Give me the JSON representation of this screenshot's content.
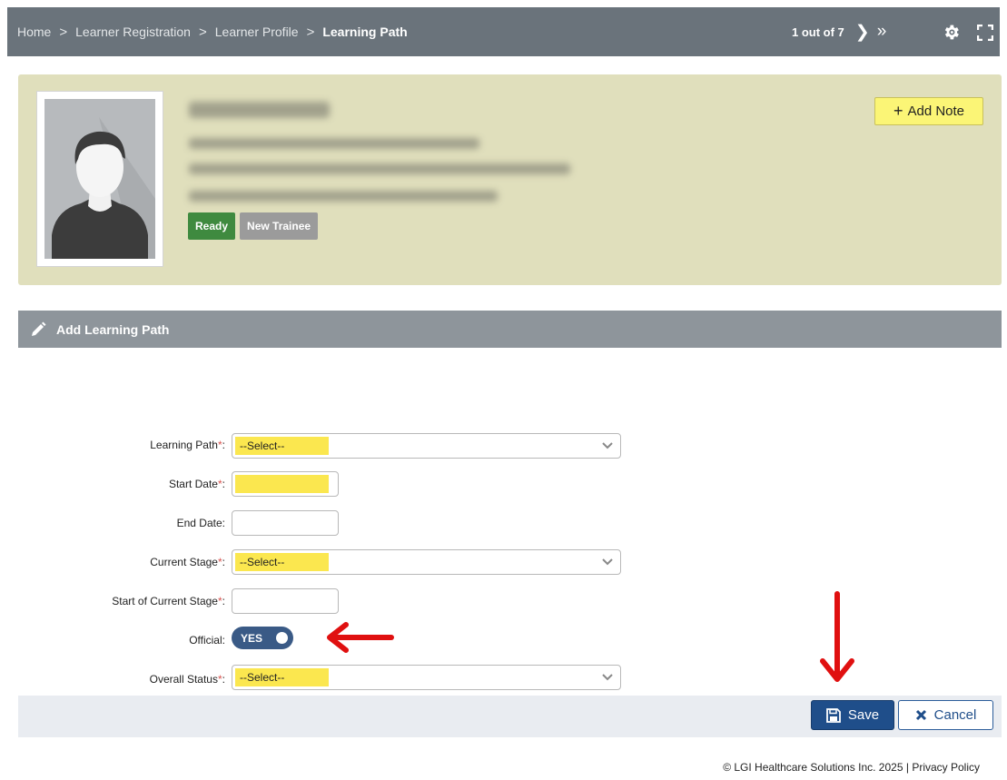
{
  "breadcrumb": {
    "items": [
      "Home",
      "Learner Registration",
      "Learner Profile"
    ],
    "current": "Learning Path"
  },
  "pager": {
    "text": "1 out of 7"
  },
  "profile": {
    "badges": {
      "ready": "Ready",
      "trainee": "New Trainee"
    },
    "add_note_label": "Add Note"
  },
  "section": {
    "title": "Add Learning Path"
  },
  "form": {
    "learning_path": {
      "label": "Learning Path",
      "value": "--Select--"
    },
    "start_date": {
      "label": "Start Date",
      "value": ""
    },
    "end_date": {
      "label": "End Date",
      "value": ""
    },
    "current_stage": {
      "label": "Current Stage",
      "value": "--Select--"
    },
    "start_current_stage": {
      "label": "Start of Current Stage",
      "value": ""
    },
    "official": {
      "label": "Official",
      "value": "YES"
    },
    "overall_status": {
      "label": "Overall Status",
      "value": "--Select--"
    }
  },
  "actions": {
    "save": "Save",
    "cancel": "Cancel"
  },
  "footer": {
    "copyright": "© LGI Healthcare Solutions Inc. 2025",
    "divider": "|",
    "privacy": "Privacy Policy"
  },
  "icons": {
    "gear": "gear-icon",
    "fullscreen": "fullscreen-icon",
    "pencil": "pencil-icon",
    "save": "floppy-disk-icon",
    "cancel": "x-icon",
    "chevron": "chevron-down-icon"
  },
  "colors": {
    "topbar": "#6a737b",
    "profile_bg": "#e0dfbc",
    "highlight": "#fbe74f",
    "save_button": "#1f4e8a",
    "ready": "#3f8a3f",
    "annotation_arrow": "#e01010"
  }
}
